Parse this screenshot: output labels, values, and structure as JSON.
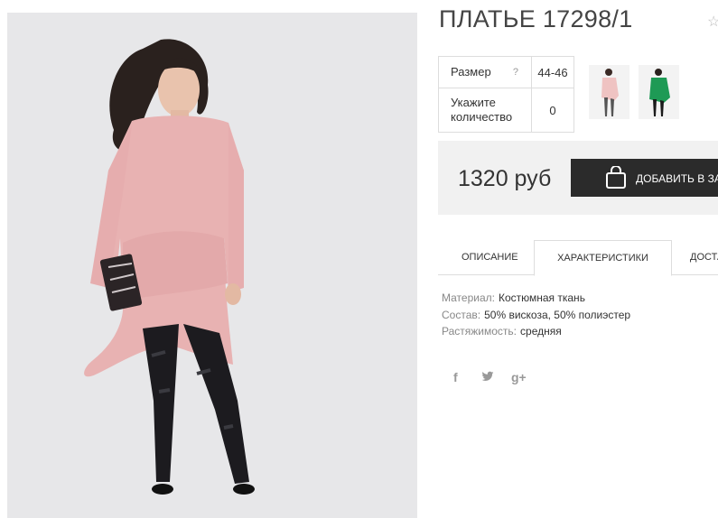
{
  "product": {
    "title": "ПЛАТЬЕ 17298/1"
  },
  "params": {
    "size_label": "Размер",
    "size_hint": "?",
    "size_value": "44-46",
    "qty_label": "Укажите количество",
    "qty_value": "0"
  },
  "thumbnails": [
    {
      "color": "#f0c9c6"
    },
    {
      "color": "#1f9a54"
    }
  ],
  "price": {
    "amount": "1320 руб",
    "add_to_cart_label": "ДОБАВИТЬ В ЗА"
  },
  "tabs": [
    {
      "label": "ОПИСАНИЕ"
    },
    {
      "label": "ХАРАКТЕРИСТИКИ"
    },
    {
      "label": "ДОСТА"
    }
  ],
  "specs": [
    {
      "key": "Материал:",
      "value": "Костюмная ткань"
    },
    {
      "key": "Состав:",
      "value": "50% вискоза, 50% полиэстер"
    },
    {
      "key": "Растяжимость:",
      "value": "средняя"
    }
  ],
  "social": [
    {
      "icon": "facebook-icon",
      "glyph": "f"
    },
    {
      "icon": "twitter-icon",
      "glyph": "t"
    },
    {
      "icon": "googleplus-icon",
      "glyph": "g+"
    }
  ]
}
